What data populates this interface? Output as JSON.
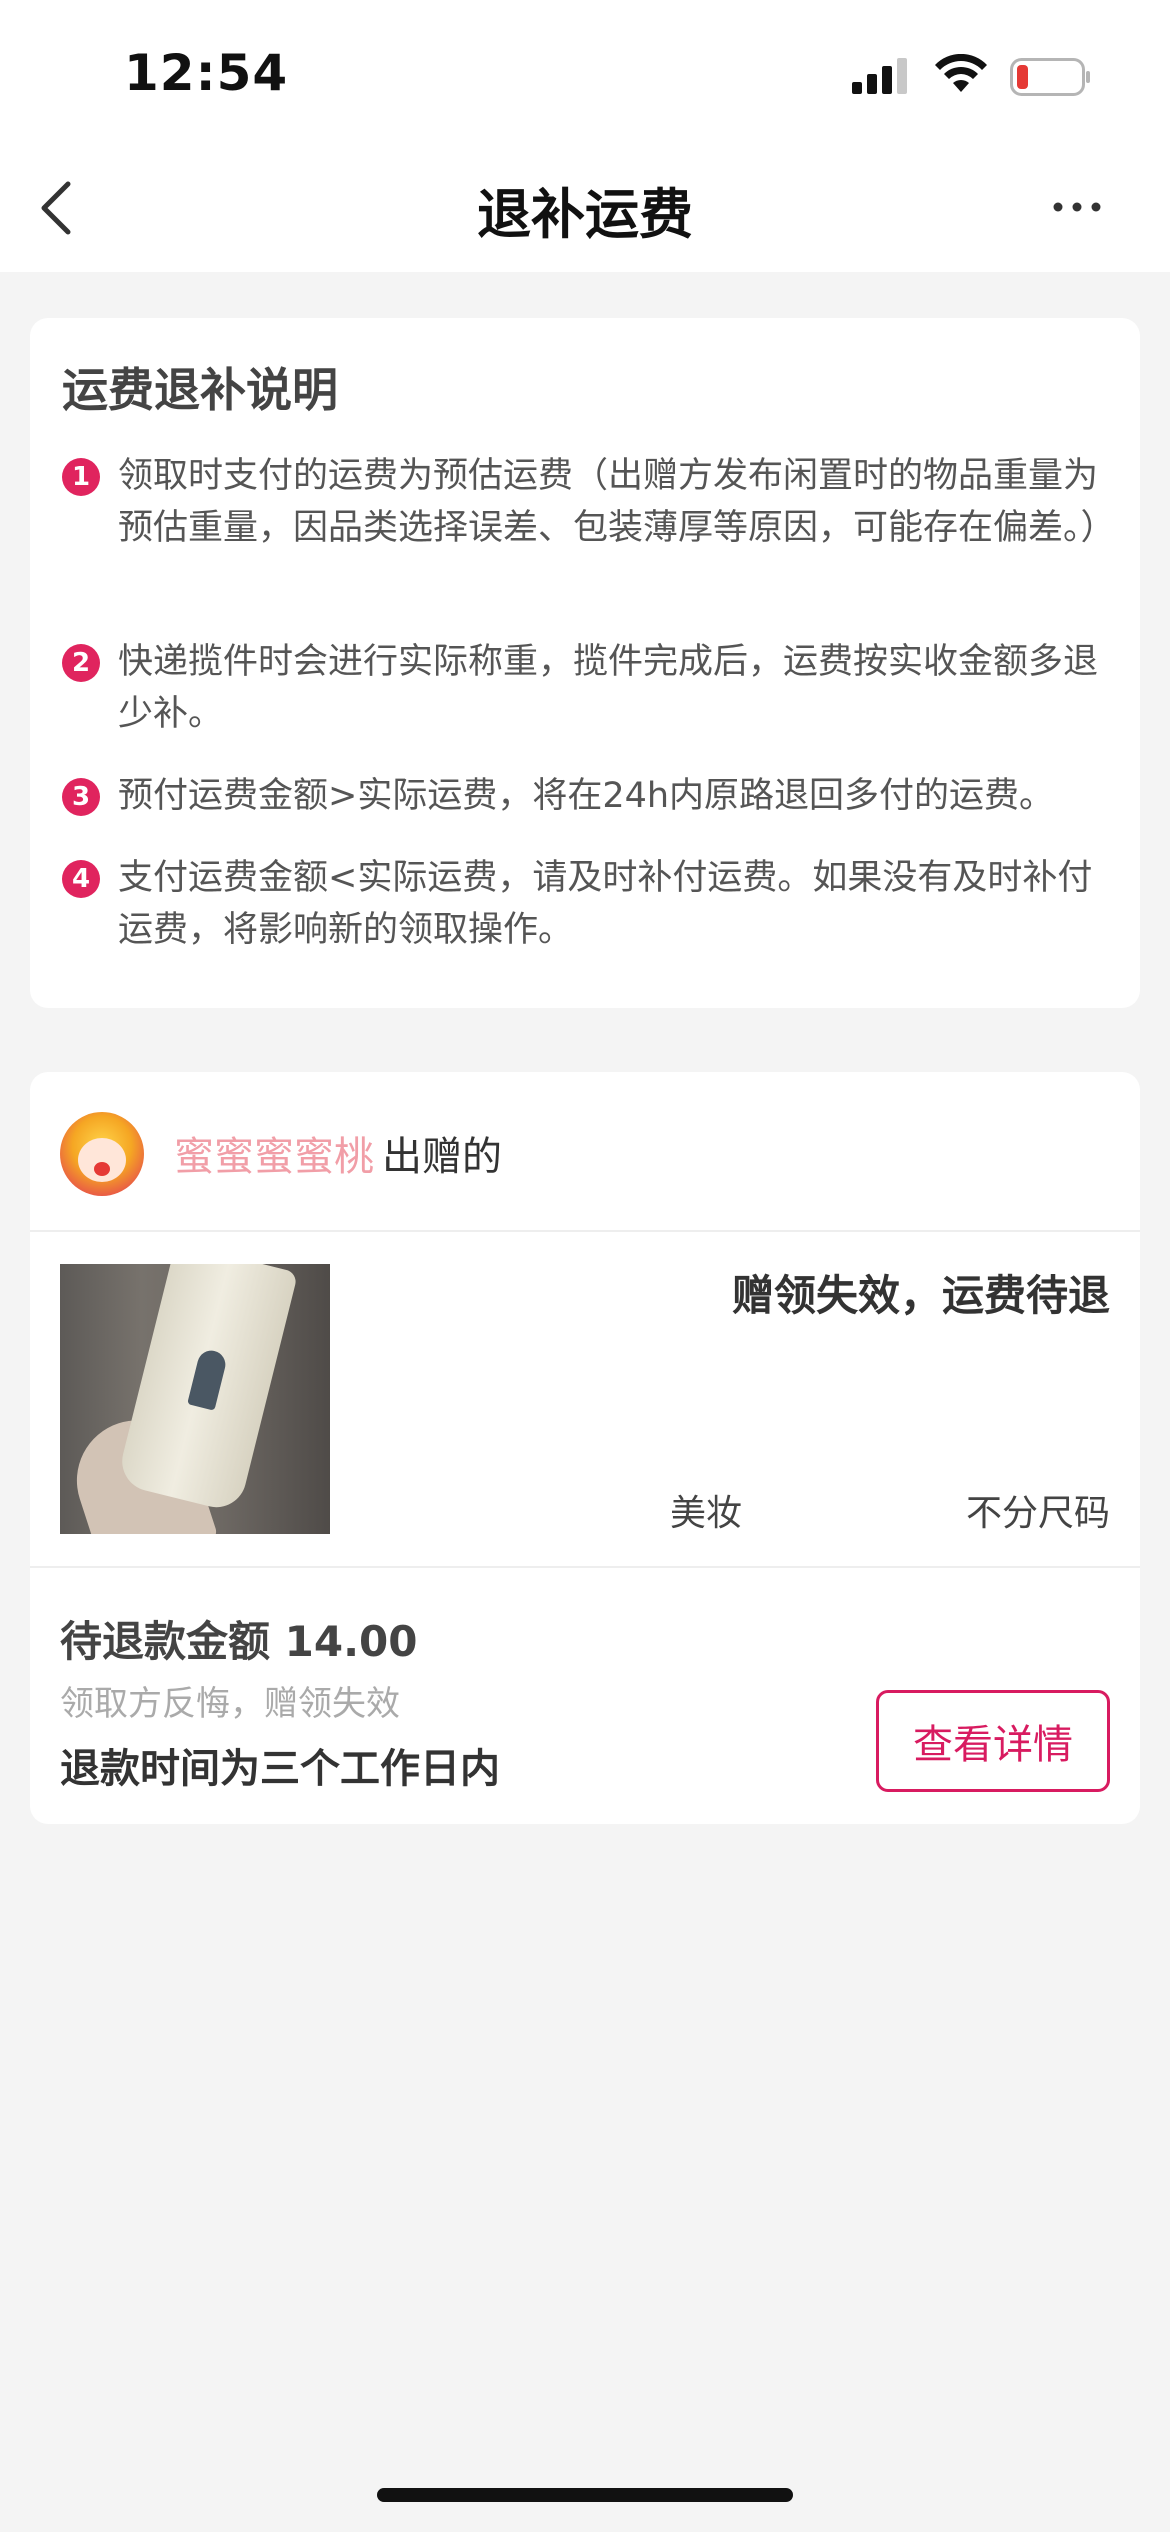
{
  "status_bar": {
    "time": "12:54",
    "icons": [
      "signal-icon",
      "wifi-icon",
      "battery-icon"
    ],
    "battery_color": "#e53935"
  },
  "nav": {
    "title": "退补运费",
    "back_icon": "chevron-left-icon",
    "more_icon": "more-horizontal-icon"
  },
  "notes": {
    "title": "运费退补说明",
    "items": [
      {
        "num": "1",
        "text": "领取时支付的运费为预估运费（出赠方发布闲置时的物品重量为预估重量，因品类选择误差、包装薄厚等原因，可能存在偏差。）"
      },
      {
        "num": "2",
        "text": "快递揽件时会进行实际称重，揽件完成后，运费按实收金额多退少补。"
      },
      {
        "num": "3",
        "text": "预付运费金额>实际运费，将在24h内原路退回多付的运费。"
      },
      {
        "num": "4",
        "text": "支付运费金额<实际运费，请及时补付运费。如果没有及时补付运费，将影响新的领取操作。"
      }
    ]
  },
  "gift": {
    "giver_name": "蜜蜜蜜蜜桃",
    "giver_suffix": "出赠的",
    "product_status": "赠领失效，运费待退",
    "category": "美妆",
    "size": "不分尺码",
    "refund_amount": "待退款金额 14.00",
    "refund_reason": "领取方反悔，赠领失效",
    "refund_time": "退款时间为三个工作日内",
    "detail_button": "查看详情"
  },
  "colors": {
    "accent": "#d81b60",
    "note_badge": "#e0245e",
    "giver_name": "#f19ea7",
    "background": "#f4f4f4"
  }
}
